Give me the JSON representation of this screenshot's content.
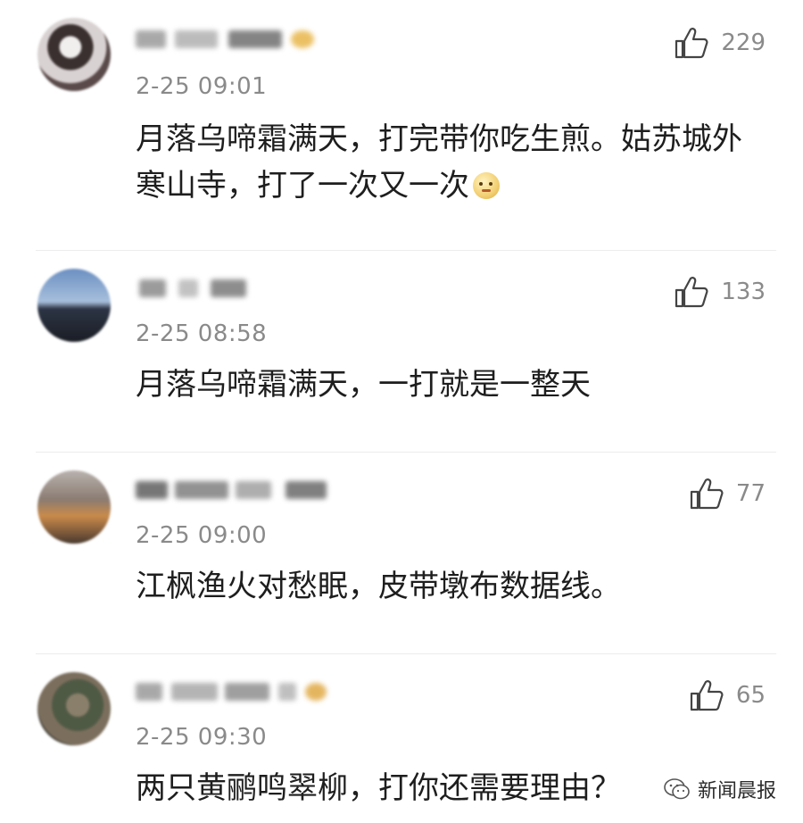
{
  "comments": [
    {
      "time": "2-25 09:01",
      "likes": "229",
      "text": "月落乌啼霜满天，打完带你吃生煎。姑苏城外寒山寺，打了一次又一次",
      "emoji": "grinning-face-icon"
    },
    {
      "time": "2-25 08:58",
      "likes": "133",
      "text": "月落乌啼霜满天，一打就是一整天"
    },
    {
      "time": "2-25 09:00",
      "likes": "77",
      "text": "江枫渔火对愁眠，皮带墩布数据线。"
    },
    {
      "time": "2-25 09:30",
      "likes": "65",
      "text": "两只黄鹂鸣翠柳，打你还需要理由？"
    }
  ],
  "watermark": {
    "text": "新闻晨报",
    "icon": "wechat-icon"
  }
}
